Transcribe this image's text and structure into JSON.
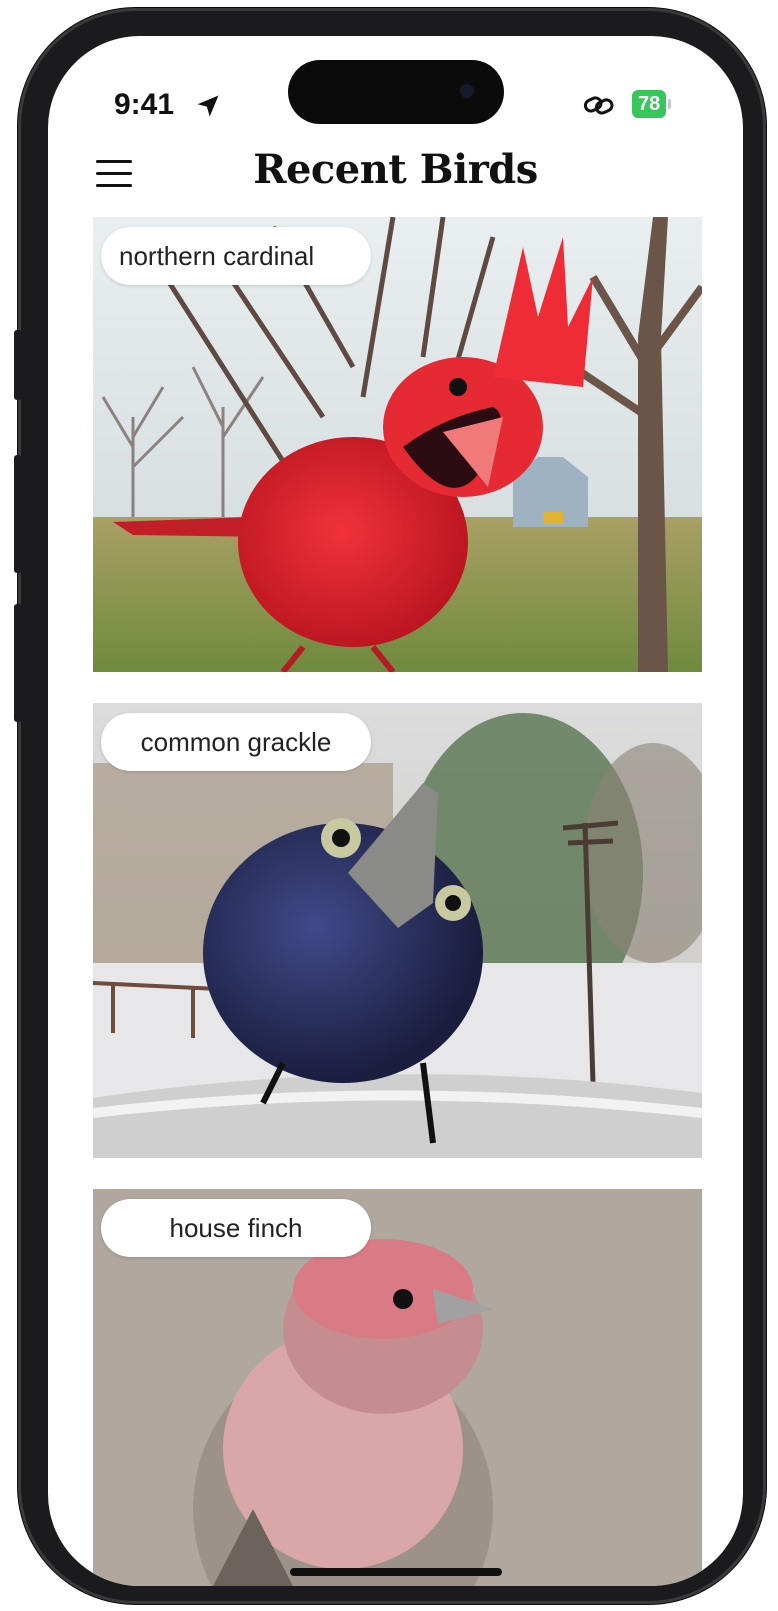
{
  "status_bar": {
    "time": "9:41",
    "battery_level": "78"
  },
  "header": {
    "title": "Recent Birds"
  },
  "birds": [
    {
      "label": "northern cardinal"
    },
    {
      "label": "common grackle"
    },
    {
      "label": "house finch"
    }
  ],
  "icons": {
    "menu": "hamburger-menu-icon",
    "location": "location-arrow-icon",
    "link": "link-icon",
    "battery": "battery-icon"
  },
  "colors": {
    "battery_green": "#35c759",
    "background": "#ffffff"
  }
}
